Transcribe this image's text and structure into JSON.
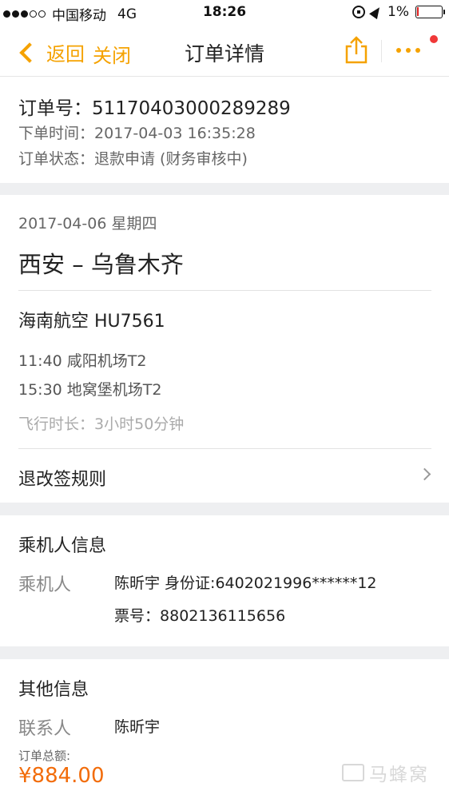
{
  "status_bar": {
    "carrier": "中国移动",
    "network": "4G",
    "time": "18:26",
    "battery": "1%",
    "battery_level": 0.01
  },
  "nav": {
    "back_label": "返回",
    "close_label": "关闭",
    "title": "订单详情"
  },
  "order": {
    "number_label": "订单号：",
    "number": "51170403000289289",
    "time_label": "下单时间：",
    "time": "2017-04-03 16:35:28",
    "status_label": "订单状态：",
    "status": "退款申请 (财务审核中)"
  },
  "flight": {
    "date": "2017-04-06 星期四",
    "route": "西安 – 乌鲁木齐",
    "airline": "海南航空 HU7561",
    "departure": "11:40 咸阳机场T2",
    "arrival": "15:30 地窝堡机场T2",
    "duration_label": "飞行时长：",
    "duration": "3小时50分钟",
    "rules": "退改签规则"
  },
  "passenger": {
    "section_title": "乘机人信息",
    "label": "乘机人",
    "name_id": "陈昕宇 身份证:6402021996******12",
    "ticket_label": "票号：",
    "ticket": "8802136115656"
  },
  "other": {
    "section_title": "其他信息",
    "contact_label": "联系人",
    "contact": "陈昕宇",
    "total_label": "订单总额:",
    "total": "¥884.00"
  },
  "watermark": "马蜂窝",
  "colors": {
    "accent": "#f5a200",
    "price": "#f26c0a",
    "notification": "#f03838"
  }
}
